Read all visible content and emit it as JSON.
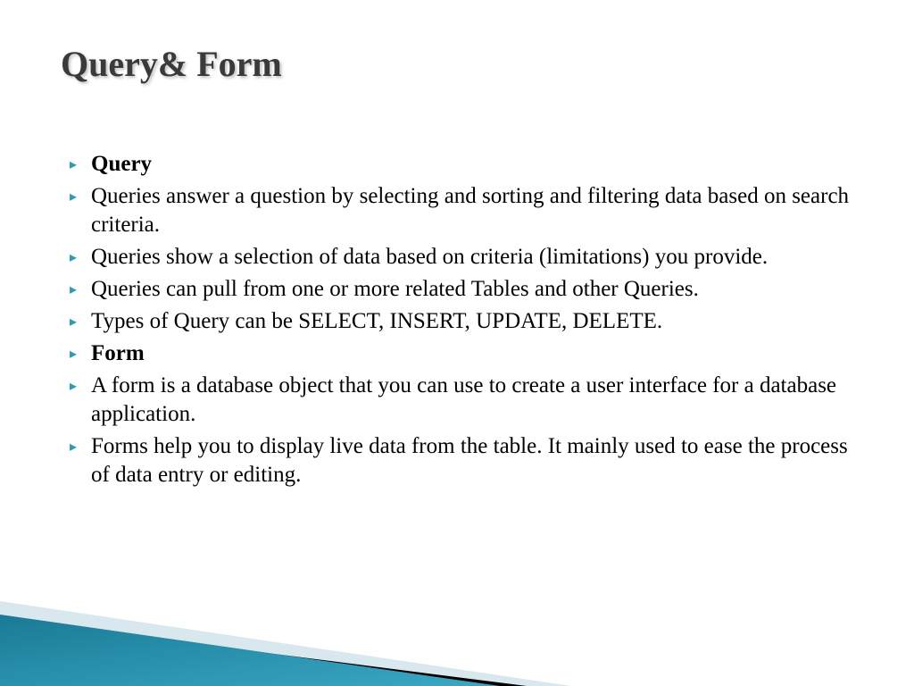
{
  "title": "Query& Form",
  "bullets": [
    {
      "text": "Query",
      "bold": true
    },
    {
      "text": "Queries answer a question by selecting and sorting and filtering data based on search criteria.",
      "bold": false
    },
    {
      "text": "Queries show a selection of data based on criteria (limitations) you provide.",
      "bold": false
    },
    {
      "text": "Queries can pull from one or more related Tables and other Queries.",
      "bold": false
    },
    {
      "text": "Types of Query can be SELECT, INSERT, UPDATE, DELETE.",
      "bold": false
    },
    {
      "text": "Form",
      "bold": true
    },
    {
      "text": "A form is a database object that you can use to create a user interface for a database application.",
      "bold": false
    },
    {
      "text": "Forms help you to display live data from the table. It mainly used to ease the process of data entry or editing.",
      "bold": false
    }
  ],
  "theme": {
    "accent": "#2b9ab3",
    "title_color": "#3a3a3a"
  }
}
